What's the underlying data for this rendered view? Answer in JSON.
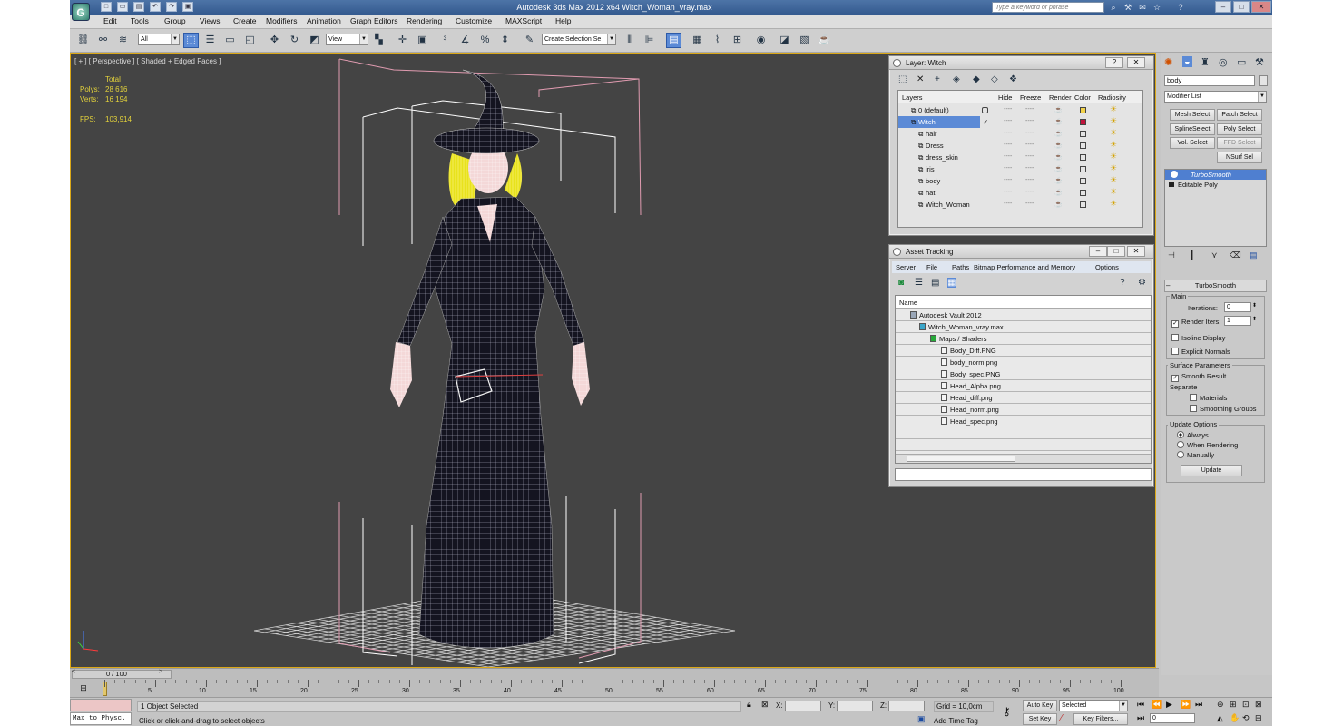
{
  "app": {
    "title": "Autodesk 3ds Max  2012 x64    Witch_Woman_vray.max",
    "search_placeholder": "Type a keyword or phrase",
    "logo_text": "G"
  },
  "quick_access": [
    "□",
    "▭",
    "▤",
    "↶",
    "↷",
    "▣"
  ],
  "menu": [
    "Edit",
    "Tools",
    "Group",
    "Views",
    "Create",
    "Modifiers",
    "Animation",
    "Graph Editors",
    "Rendering",
    "Customize",
    "MAXScript",
    "Help"
  ],
  "toolbar": {
    "selection_filter": "All",
    "reference_coord": "View",
    "named_selection": "Create Selection Se"
  },
  "viewport": {
    "label": "[ + ] [ Perspective ] [ Shaded + Edged Faces ]",
    "stats_title": "Total",
    "polys_label": "Polys:",
    "polys_value": "28 616",
    "verts_label": "Verts:",
    "verts_value": "16 194",
    "fps_label": "FPS:",
    "fps_value": "103,914"
  },
  "layer_panel": {
    "title": "Layer: Witch",
    "columns": [
      "Layers",
      "Hide",
      "Freeze",
      "Render",
      "Color",
      "Radiosity"
    ],
    "rows": [
      {
        "name": "0 (default)",
        "indent": 0,
        "color": "#f2d24a",
        "selected": false
      },
      {
        "name": "Witch",
        "indent": 0,
        "color": "#c0143c",
        "selected": true
      },
      {
        "name": "hair",
        "indent": 1,
        "color": "",
        "selected": false
      },
      {
        "name": "Dress",
        "indent": 1,
        "color": "",
        "selected": false
      },
      {
        "name": "dress_skin",
        "indent": 1,
        "color": "",
        "selected": false
      },
      {
        "name": "iris",
        "indent": 1,
        "color": "",
        "selected": false
      },
      {
        "name": "body",
        "indent": 1,
        "color": "",
        "selected": false
      },
      {
        "name": "hat",
        "indent": 1,
        "color": "",
        "selected": false
      },
      {
        "name": "Witch_Woman",
        "indent": 1,
        "color": "",
        "selected": false
      }
    ],
    "dash": "----"
  },
  "asset_panel": {
    "title": "Asset Tracking",
    "menus": [
      "Server",
      "File",
      "Paths",
      "Bitmap Performance and Memory",
      "Options"
    ],
    "column": "Name",
    "rows": [
      {
        "name": "Autodesk Vault 2012",
        "level": 0
      },
      {
        "name": "Witch_Woman_vray.max",
        "level": 1
      },
      {
        "name": "Maps / Shaders",
        "level": 2
      },
      {
        "name": "Body_Diff.PNG",
        "level": 3
      },
      {
        "name": "body_norm.png",
        "level": 3
      },
      {
        "name": "Body_spec.PNG",
        "level": 3
      },
      {
        "name": "Head_Alpha.png",
        "level": 3
      },
      {
        "name": "Head_diff.png",
        "level": 3
      },
      {
        "name": "Head_norm.png",
        "level": 3
      },
      {
        "name": "Head_spec.png",
        "level": 3
      }
    ]
  },
  "command_panel": {
    "object_name": "body",
    "modifier_list": "Modifier List",
    "buttons": [
      "Mesh Select",
      "Patch Select",
      "SplineSelect",
      "Poly Select",
      "Vol. Select",
      "FFD Select",
      "NSurf Sel"
    ],
    "stack": [
      "TurboSmooth",
      "Editable Poly"
    ],
    "rollout_title": "TurboSmooth",
    "main_label": "Main",
    "iterations_label": "Iterations:",
    "iterations_value": "0",
    "render_iters_label": "Render Iters:",
    "render_iters_value": "1",
    "isoline": "Isoline Display",
    "explicit_normals": "Explicit Normals",
    "surface_params": "Surface Parameters",
    "smooth_result": "Smooth Result",
    "separate": "Separate",
    "materials": "Materials",
    "smoothing_groups": "Smoothing Groups",
    "update_options": "Update Options",
    "always": "Always",
    "when_rendering": "When Rendering",
    "manually": "Manually",
    "update_button": "Update"
  },
  "timeline": {
    "frame": "0 / 100",
    "ticks": [
      "0",
      "5",
      "10",
      "15",
      "20",
      "25",
      "30",
      "35",
      "40",
      "45",
      "50",
      "55",
      "60",
      "65",
      "70",
      "75",
      "80",
      "85",
      "90",
      "95",
      "100"
    ]
  },
  "status": {
    "script_label": "Max to Physc.",
    "selected": "1 Object Selected",
    "prompt": "Click or click-and-drag to select objects",
    "x_label": "X:",
    "y_label": "Y:",
    "z_label": "Z:",
    "grid": "Grid = 10,0cm",
    "add_time_tag": "Add Time Tag",
    "auto_key": "Auto Key",
    "key_mode": "Selected",
    "set_key": "Set Key",
    "key_filters": "Key Filters...",
    "frame_field": "0"
  }
}
